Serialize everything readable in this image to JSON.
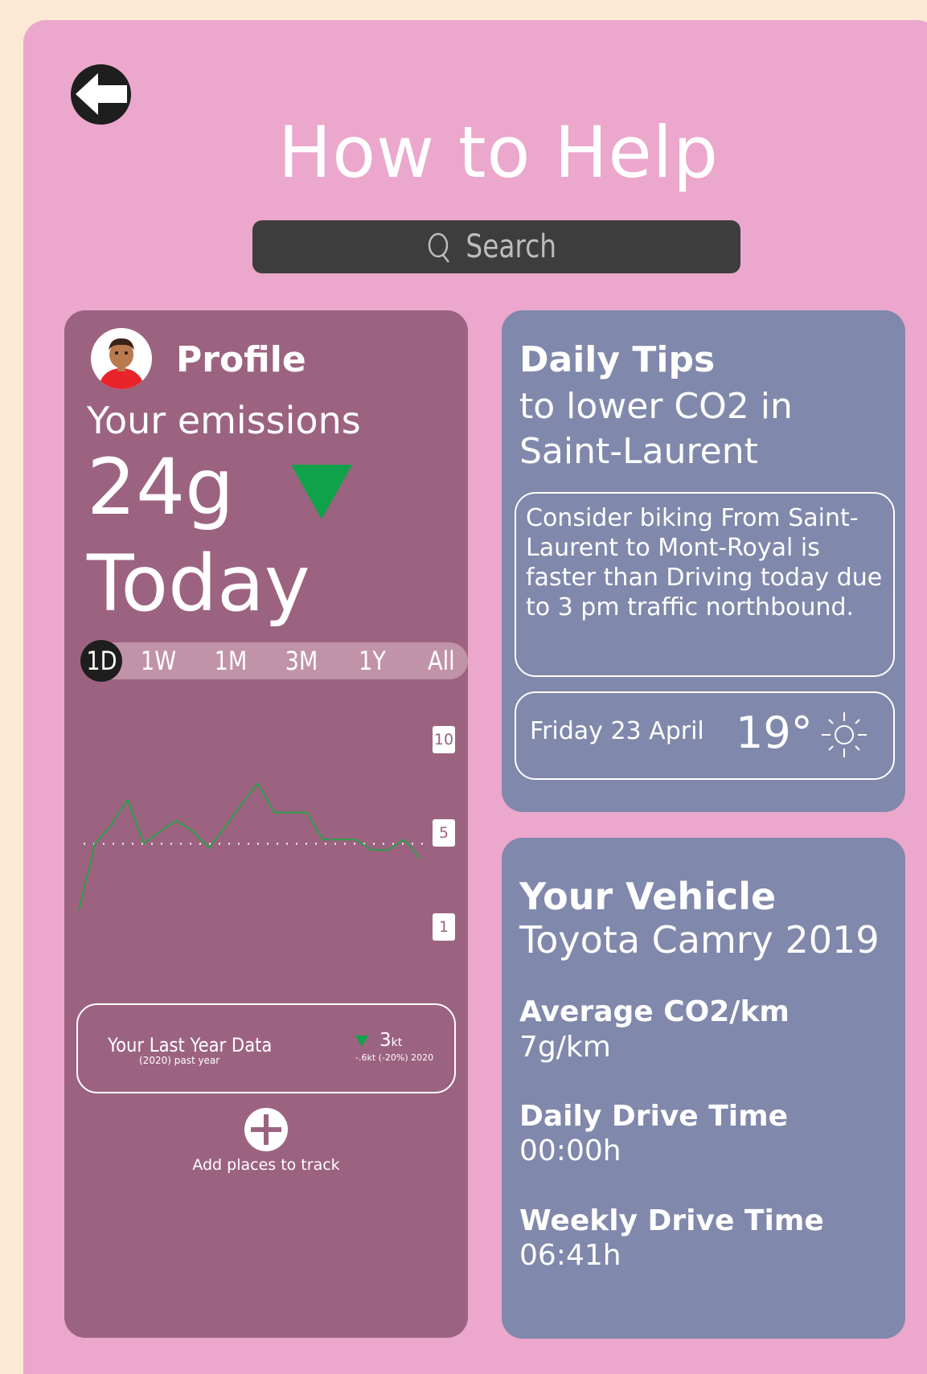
{
  "page": {
    "title": "How to Help"
  },
  "search": {
    "placeholder": "Search"
  },
  "profile": {
    "title": "Profile",
    "emissions_label": "Your emissions",
    "emissions_value": "24g",
    "emissions_period": "Today",
    "trend": "down",
    "trend_color": "#0FA24A"
  },
  "range_tabs": [
    {
      "label": "1D",
      "active": true
    },
    {
      "label": "1W",
      "active": false
    },
    {
      "label": "1M",
      "active": false
    },
    {
      "label": "3M",
      "active": false
    },
    {
      "label": "1Y",
      "active": false
    },
    {
      "label": "All",
      "active": false
    }
  ],
  "chart_data": {
    "type": "line",
    "title": "",
    "xlabel": "",
    "ylabel": "",
    "y_ticks": [
      "10",
      "5",
      "1"
    ],
    "ylim": [
      1,
      10
    ],
    "reference_line": 5,
    "series": [
      {
        "color": "#29A04A",
        "values": [
          1.8,
          5.0,
          5.9,
          7.1,
          5.0,
          5.6,
          6.1,
          5.6,
          4.8,
          5.8,
          6.9,
          7.9,
          6.5,
          6.5,
          6.5,
          5.2,
          5.2,
          5.2,
          4.7,
          4.7,
          5.2,
          4.3
        ]
      }
    ]
  },
  "last_year": {
    "title": "Your Last Year Data",
    "subtitle": "(2020) past year",
    "value": "3",
    "unit": "kt",
    "change": "-.6kt (-20%) 2020"
  },
  "add_places": {
    "label": "Add places to track"
  },
  "tips": {
    "title": "Daily Tips",
    "subtitle": "to lower CO2 in Saint-Laurent",
    "tip_text": "Consider biking From Saint-Laurent to Mont-Royal is faster than Driving today due to 3 pm traffic northbound.",
    "weather_date": "Friday 23 April",
    "weather_temp": "19°",
    "weather_icon": "sun-icon"
  },
  "vehicle": {
    "title": "Your Vehicle",
    "model": "Toyota Camry 2019",
    "stats": [
      {
        "label": "Average CO2/km",
        "value": "7g/km"
      },
      {
        "label": "Daily Drive Time",
        "value": "00:00h"
      },
      {
        "label": "Weekly Drive Time",
        "value": "06:41h"
      }
    ]
  },
  "colors": {
    "page_bg": "#FBE9D6",
    "frame": "#EBA7CC",
    "profile_card": "#9C6380",
    "info_card": "#8088AB",
    "search_bg": "#3D3D3D"
  }
}
